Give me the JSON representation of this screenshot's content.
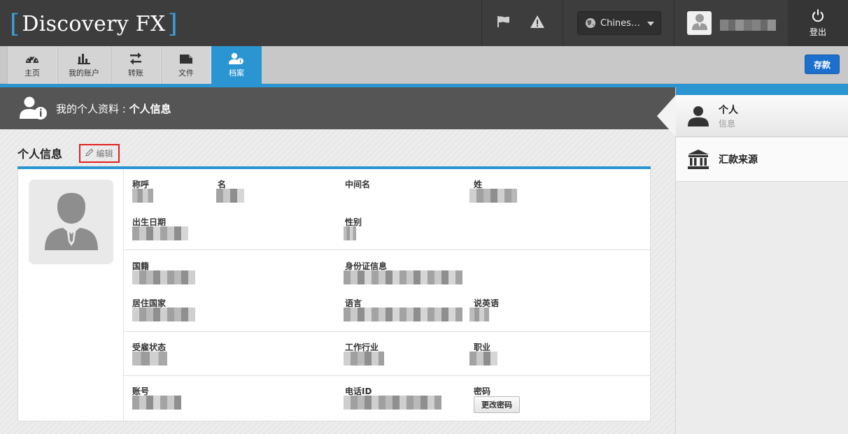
{
  "header": {
    "logo_text": "Discovery FX",
    "language": "Chines…",
    "logout_label": "登出",
    "icons": [
      "flag-icon",
      "warning-icon",
      "globe-icon",
      "user-icon",
      "power-icon"
    ]
  },
  "nav": {
    "items": [
      {
        "label": "主页",
        "icon": "dashboard-icon"
      },
      {
        "label": "我的账户",
        "icon": "bar-chart-icon"
      },
      {
        "label": "转账",
        "icon": "transfer-icon"
      },
      {
        "label": "文件",
        "icon": "folder-icon"
      },
      {
        "label": "档案",
        "icon": "profile-icon",
        "active": true
      }
    ],
    "deposit_label": "存款"
  },
  "section": {
    "title_prefix": "我的个人资料 : ",
    "title_current": "个人信息"
  },
  "personal": {
    "title": "个人信息",
    "edit_label": "编辑",
    "fields": {
      "salutation": "称呼",
      "first_name": "名",
      "middle_name": "中间名",
      "last_name": "姓",
      "dob": "出生日期",
      "gender": "性别",
      "nationality": "国籍",
      "id_info": "身份证信息",
      "country_residence": "居住国家",
      "language": "语言",
      "speaks_english": "说英语",
      "employment_status": "受雇状态",
      "industry": "工作行业",
      "occupation": "职业",
      "account_number": "账号",
      "phone_id": "电话ID",
      "password": "密码"
    },
    "change_password_label": "更改密码"
  },
  "sidebar": {
    "items": [
      {
        "label": "个人",
        "sub": "信息",
        "icon": "person-icon",
        "active": true
      },
      {
        "label": "汇款来源",
        "icon": "bank-icon"
      }
    ]
  },
  "colors": {
    "accent": "#2b95d2",
    "topbar": "#3d3d3d",
    "deposit": "#1c6fcc",
    "edit_highlight": "#e02020"
  }
}
